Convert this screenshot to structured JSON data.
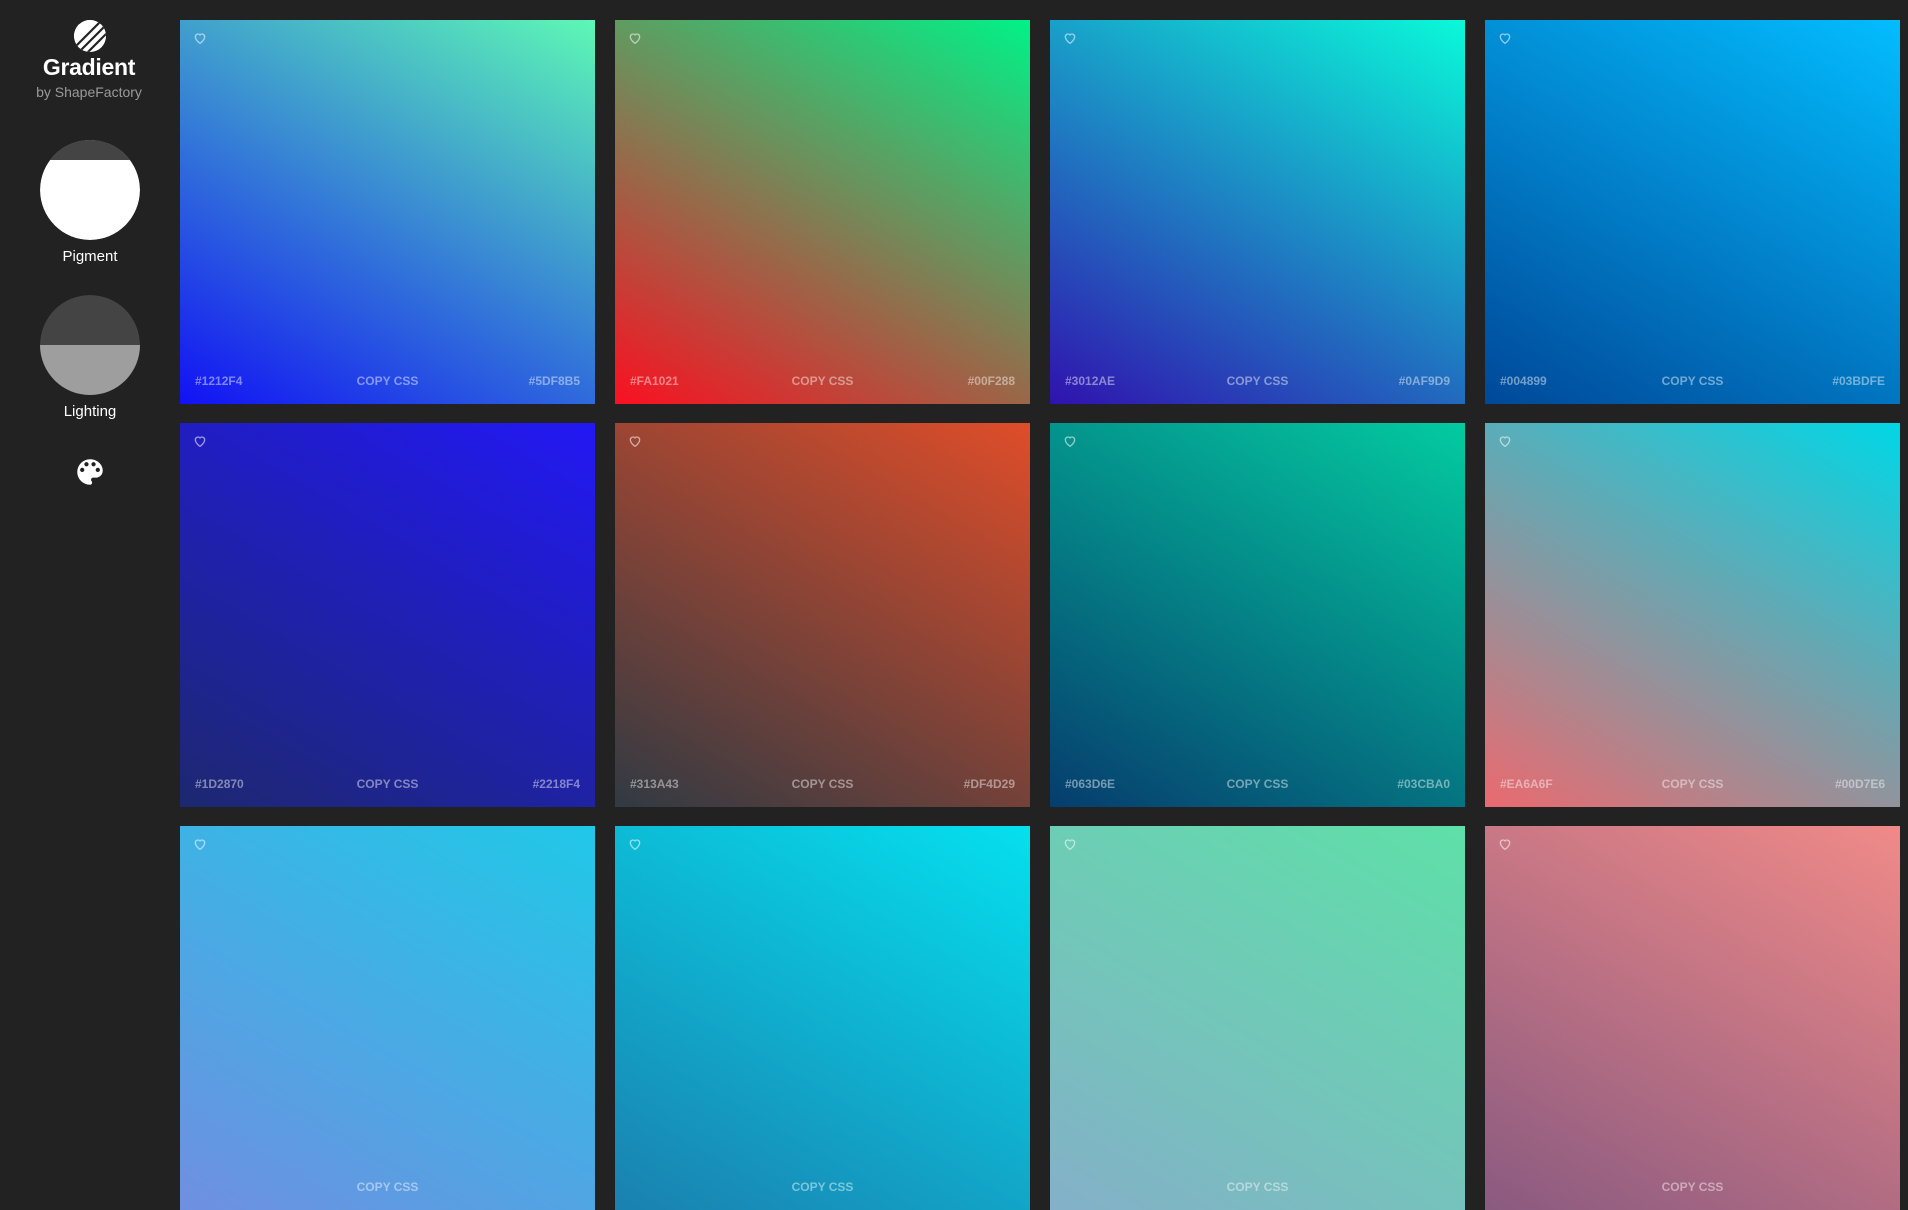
{
  "brand": {
    "title": "Gradient",
    "subtitle": "by ShapeFactory",
    "logo_icon": "striped-circle-logo"
  },
  "modes": [
    {
      "label": "Pigment",
      "icon": "pigment-mode-icon"
    },
    {
      "label": "Lighting",
      "icon": "lighting-mode-icon"
    }
  ],
  "palette": {
    "icon": "palette-icon"
  },
  "copy_label": "COPY CSS",
  "cards": [
    {
      "from": "#1212F4",
      "to": "#5DF8B5",
      "from_color": "#1212F4",
      "to_color": "#5DF8B5",
      "angle": 30
    },
    {
      "from": "#FA1021",
      "to": "#00F288",
      "from_color": "#FA1021",
      "to_color": "#00F288",
      "angle": 30
    },
    {
      "from": "#3012AE",
      "to": "#0AF9D9",
      "from_color": "#3012AE",
      "to_color": "#0AF9D9",
      "angle": 30
    },
    {
      "from": "#004899",
      "to": "#03BDFE",
      "from_color": "#004899",
      "to_color": "#03BDFE",
      "angle": 30
    },
    {
      "from": "#1D2870",
      "to": "#2218F4",
      "from_color": "#1D2870",
      "to_color": "#2218F4",
      "angle": 30
    },
    {
      "from": "#313A43",
      "to": "#DF4D29",
      "from_color": "#313A43",
      "to_color": "#DF4D29",
      "angle": 30
    },
    {
      "from": "#063D6E",
      "to": "#03CBA0",
      "from_color": "#063D6E",
      "to_color": "#03CBA0",
      "angle": 30
    },
    {
      "from": "#EA6A6F",
      "to": "#00D7E6",
      "from_color": "#EA6A6F",
      "to_color": "#00D7E6",
      "angle": 30
    },
    {
      "from": "",
      "to": "",
      "from_color": "#6F8FE0",
      "to_color": "#20C8E8",
      "angle": 30
    },
    {
      "from": "",
      "to": "",
      "from_color": "#1A80B0",
      "to_color": "#05E0EE",
      "angle": 30
    },
    {
      "from": "",
      "to": "",
      "from_color": "#84B0C8",
      "to_color": "#5EE0A8",
      "angle": 30
    },
    {
      "from": "",
      "to": "",
      "from_color": "#8A5A80",
      "to_color": "#F08A88",
      "angle": 30
    }
  ]
}
